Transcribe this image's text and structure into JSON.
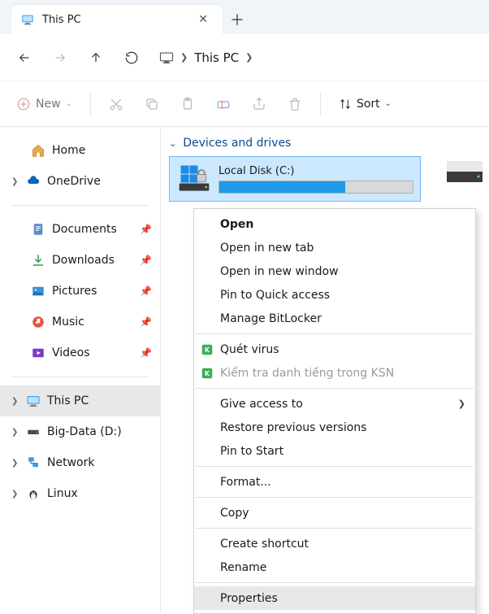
{
  "tab": {
    "title": "This PC"
  },
  "address": {
    "location": "This PC"
  },
  "toolbar": {
    "new": "New",
    "sort": "Sort"
  },
  "sidebar": {
    "home": "Home",
    "onedrive": "OneDrive",
    "documents": "Documents",
    "downloads": "Downloads",
    "pictures": "Pictures",
    "music": "Music",
    "videos": "Videos",
    "thispc": "This PC",
    "bigdata": "Big-Data (D:)",
    "network": "Network",
    "linux": "Linux"
  },
  "content": {
    "group": "Devices and drives",
    "drive_c": {
      "name": "Local Disk (C:)"
    }
  },
  "context_menu": {
    "open": "Open",
    "open_new_tab": "Open in new tab",
    "open_new_window": "Open in new window",
    "pin_quick": "Pin to Quick access",
    "manage_bitlocker": "Manage BitLocker",
    "scan_virus": "Quét virus",
    "ksn_check": "Kiểm tra danh tiếng trong KSN",
    "give_access": "Give access to",
    "restore_versions": "Restore previous versions",
    "pin_start": "Pin to Start",
    "format": "Format...",
    "copy": "Copy",
    "create_shortcut": "Create shortcut",
    "rename": "Rename",
    "properties": "Properties"
  }
}
